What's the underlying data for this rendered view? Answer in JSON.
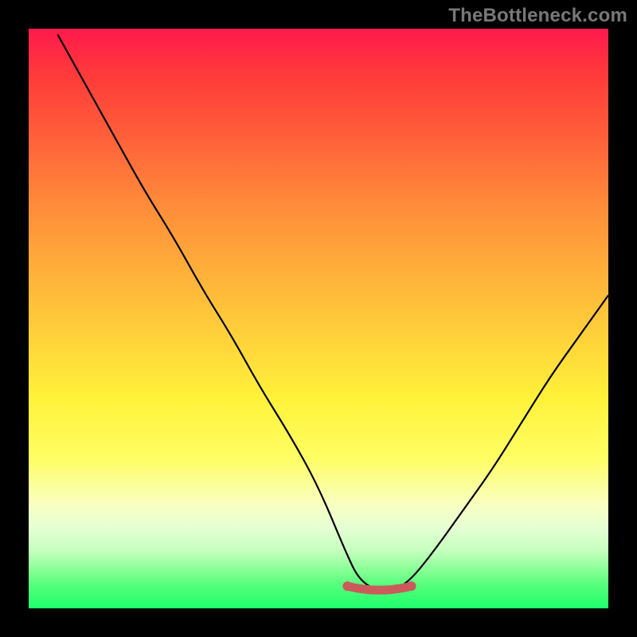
{
  "watermark": "TheBottleneck.com",
  "colors": {
    "background": "#000000",
    "curve": "#000000",
    "valley_band": "#cb5a5a",
    "gradient_top": "#ff1a4d",
    "gradient_bottom": "#1eff6b",
    "watermark": "#787878"
  },
  "chart_data": {
    "type": "line",
    "title": "",
    "xlabel": "",
    "ylabel": "",
    "xlim": [
      0,
      100
    ],
    "ylim": [
      0,
      100
    ],
    "annotations": [
      {
        "kind": "valley-band",
        "x_start": 55,
        "x_end": 66,
        "y": 3,
        "color": "#cb5a5a"
      }
    ],
    "series": [
      {
        "name": "bottleneck-curve",
        "x": [
          5,
          10,
          15,
          20,
          25,
          30,
          35,
          40,
          45,
          50,
          55,
          57,
          60,
          63,
          66,
          70,
          75,
          80,
          85,
          90,
          95,
          100
        ],
        "y": [
          99,
          90,
          81,
          72,
          64,
          55,
          47,
          38,
          30,
          21,
          9,
          5,
          3,
          3,
          5,
          10,
          17,
          24,
          32,
          40,
          47,
          54
        ]
      }
    ]
  }
}
